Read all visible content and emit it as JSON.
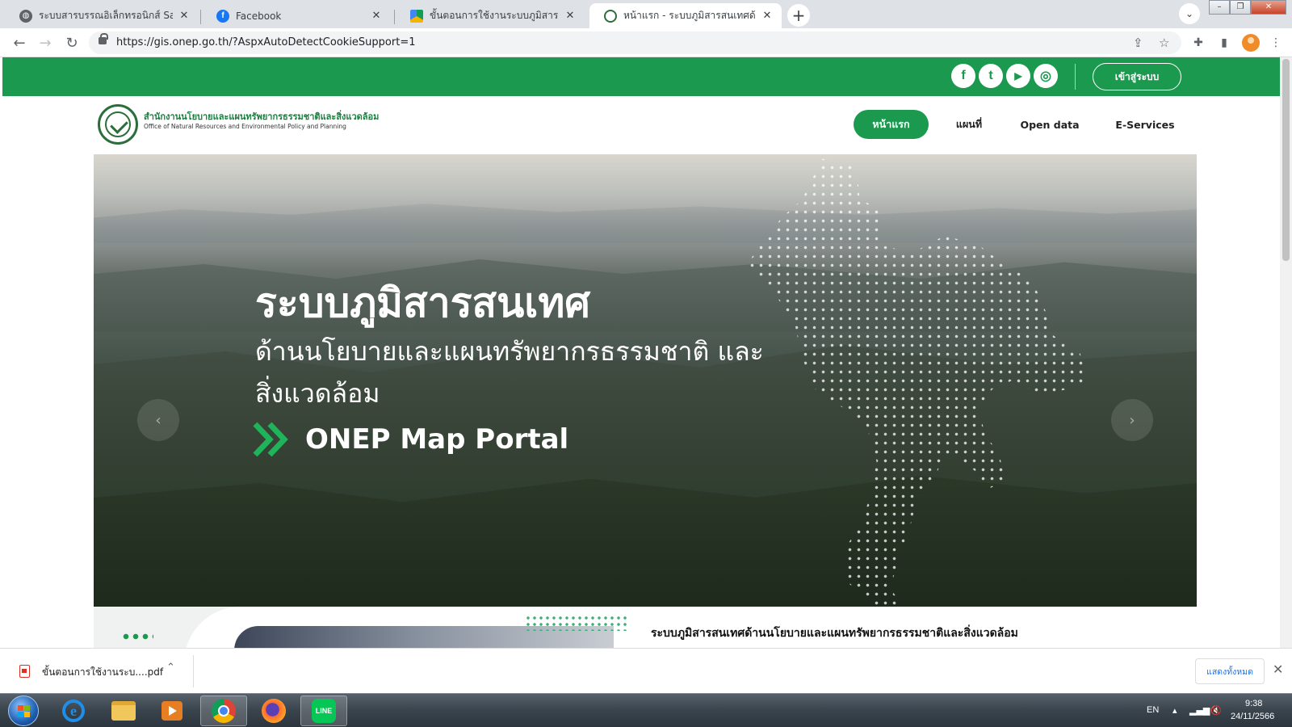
{
  "browser": {
    "tabs": [
      {
        "title": "ระบบสารบรรณอิเล็กทรอนิกส์ Saraban",
        "favicon": "globe-icon"
      },
      {
        "title": "Facebook",
        "favicon": "facebook-icon"
      },
      {
        "title": "ขั้นตอนการใช้งานระบบภูมิสารสนเทศด้",
        "favicon": "google-drive-icon"
      },
      {
        "title": "หน้าแรก - ระบบภูมิสารสนเทศด้านนโย",
        "favicon": "onep-logo-icon"
      }
    ],
    "url": "https://gis.onep.go.th/?AspxAutoDetectCookieSupport=1"
  },
  "site": {
    "login_label": "เข้าสู่ระบบ",
    "social": [
      "f",
      "t",
      "▶",
      "◎"
    ],
    "org_th": "สำนักงานนโยบายและแผนทรัพยากรธรรมชาติและสิ่งแวดล้อม",
    "org_en": "Office of Natural Resources and Environmental Policy and Planning",
    "menu": [
      "หน้าแรก",
      "แผนที่",
      "Open data",
      "E-Services"
    ]
  },
  "hero": {
    "title": "ระบบภูมิสารสนเทศ",
    "subtitle": "ด้านนโยบายและแผนทรัพยากรธรรมชาติ และสิ่งแวดล้อม",
    "portal": "ONEP Map Portal",
    "prev": "‹",
    "next": "›"
  },
  "section": {
    "title": "ระบบภูมิสารสนเทศด้านนโยบายและแผนทรัพยากรธรรมชาติและสิ่งแวดล้อม"
  },
  "download": {
    "filename": "ขั้นตอนการใช้งานระบ....pdf",
    "show_all": "แสดงทั้งหมด"
  },
  "taskbar": {
    "lang": "EN",
    "time": "9:38",
    "date": "24/11/2566"
  },
  "colors": {
    "brand_green": "#1b9a4f"
  }
}
